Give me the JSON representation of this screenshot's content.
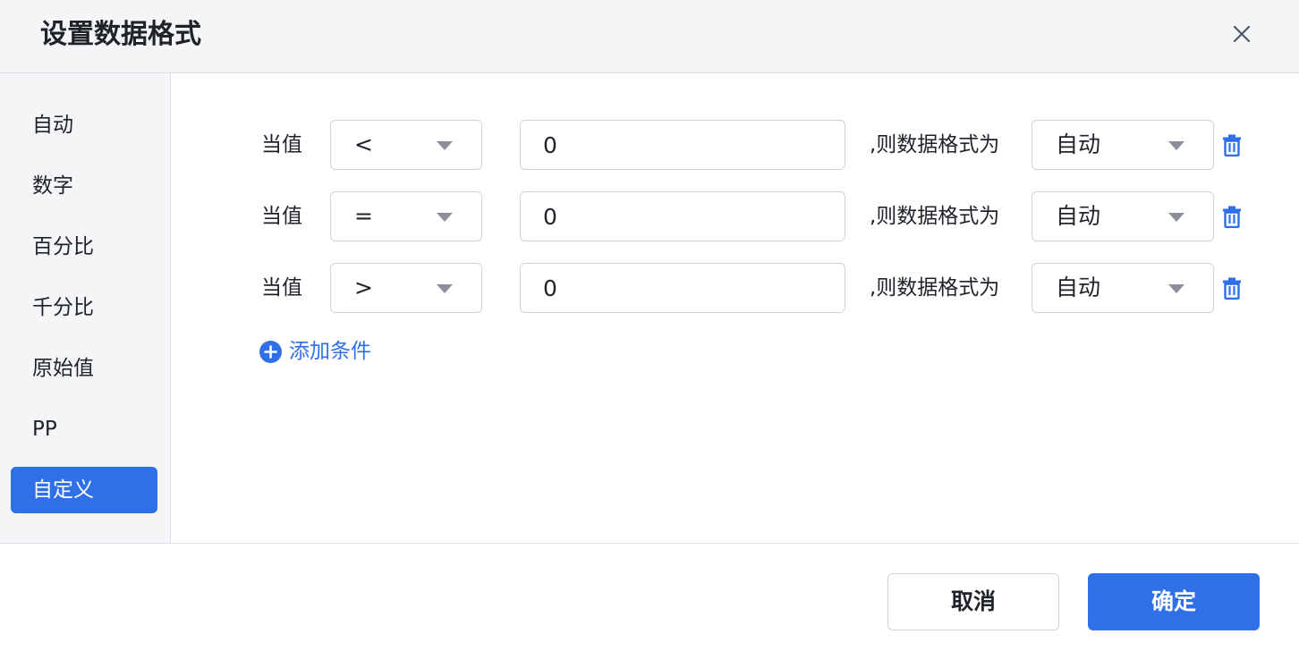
{
  "dialog": {
    "title": "设置数据格式"
  },
  "sidebar": {
    "items": [
      {
        "label": "自动"
      },
      {
        "label": "数字"
      },
      {
        "label": "百分比"
      },
      {
        "label": "千分比"
      },
      {
        "label": "原始值"
      },
      {
        "label": "PP"
      },
      {
        "label": "自定义"
      }
    ],
    "active_index": 6
  },
  "conditions": {
    "rows": [
      {
        "prefix": "当值",
        "operator": "<",
        "value": "0",
        "middle": ",则数据格式为",
        "format": "自动"
      },
      {
        "prefix": "当值",
        "operator": "=",
        "value": "0",
        "middle": ",则数据格式为",
        "format": "自动"
      },
      {
        "prefix": "当值",
        "operator": ">",
        "value": "0",
        "middle": ",则数据格式为",
        "format": "自动"
      }
    ],
    "add_label": "添加条件"
  },
  "footer": {
    "cancel_label": "取消",
    "ok_label": "确定"
  },
  "icons": {
    "close": "close-icon",
    "caret": "caret-down-icon",
    "delete": "trash-icon",
    "add": "plus-circle-icon"
  },
  "colors": {
    "accent": "#2f6fe8",
    "header_bg": "#f4f5f7",
    "border": "#d0d3d9"
  }
}
